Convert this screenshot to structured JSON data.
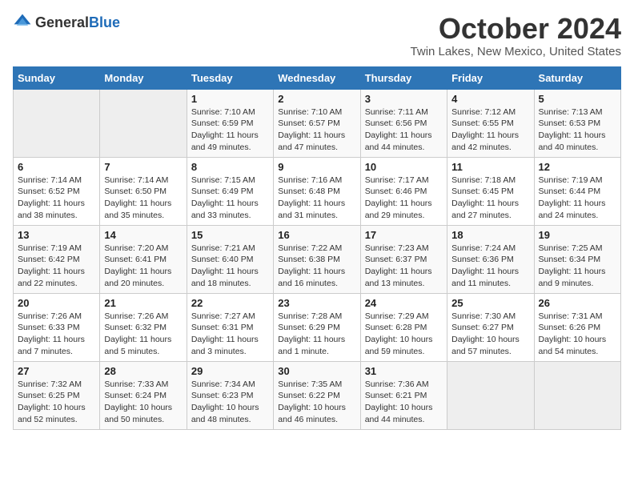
{
  "header": {
    "logo_general": "General",
    "logo_blue": "Blue",
    "title": "October 2024",
    "subtitle": "Twin Lakes, New Mexico, United States"
  },
  "days_of_week": [
    "Sunday",
    "Monday",
    "Tuesday",
    "Wednesday",
    "Thursday",
    "Friday",
    "Saturday"
  ],
  "weeks": [
    [
      {
        "day": "",
        "info": ""
      },
      {
        "day": "",
        "info": ""
      },
      {
        "day": "1",
        "info": "Sunrise: 7:10 AM\nSunset: 6:59 PM\nDaylight: 11 hours and 49 minutes."
      },
      {
        "day": "2",
        "info": "Sunrise: 7:10 AM\nSunset: 6:57 PM\nDaylight: 11 hours and 47 minutes."
      },
      {
        "day": "3",
        "info": "Sunrise: 7:11 AM\nSunset: 6:56 PM\nDaylight: 11 hours and 44 minutes."
      },
      {
        "day": "4",
        "info": "Sunrise: 7:12 AM\nSunset: 6:55 PM\nDaylight: 11 hours and 42 minutes."
      },
      {
        "day": "5",
        "info": "Sunrise: 7:13 AM\nSunset: 6:53 PM\nDaylight: 11 hours and 40 minutes."
      }
    ],
    [
      {
        "day": "6",
        "info": "Sunrise: 7:14 AM\nSunset: 6:52 PM\nDaylight: 11 hours and 38 minutes."
      },
      {
        "day": "7",
        "info": "Sunrise: 7:14 AM\nSunset: 6:50 PM\nDaylight: 11 hours and 35 minutes."
      },
      {
        "day": "8",
        "info": "Sunrise: 7:15 AM\nSunset: 6:49 PM\nDaylight: 11 hours and 33 minutes."
      },
      {
        "day": "9",
        "info": "Sunrise: 7:16 AM\nSunset: 6:48 PM\nDaylight: 11 hours and 31 minutes."
      },
      {
        "day": "10",
        "info": "Sunrise: 7:17 AM\nSunset: 6:46 PM\nDaylight: 11 hours and 29 minutes."
      },
      {
        "day": "11",
        "info": "Sunrise: 7:18 AM\nSunset: 6:45 PM\nDaylight: 11 hours and 27 minutes."
      },
      {
        "day": "12",
        "info": "Sunrise: 7:19 AM\nSunset: 6:44 PM\nDaylight: 11 hours and 24 minutes."
      }
    ],
    [
      {
        "day": "13",
        "info": "Sunrise: 7:19 AM\nSunset: 6:42 PM\nDaylight: 11 hours and 22 minutes."
      },
      {
        "day": "14",
        "info": "Sunrise: 7:20 AM\nSunset: 6:41 PM\nDaylight: 11 hours and 20 minutes."
      },
      {
        "day": "15",
        "info": "Sunrise: 7:21 AM\nSunset: 6:40 PM\nDaylight: 11 hours and 18 minutes."
      },
      {
        "day": "16",
        "info": "Sunrise: 7:22 AM\nSunset: 6:38 PM\nDaylight: 11 hours and 16 minutes."
      },
      {
        "day": "17",
        "info": "Sunrise: 7:23 AM\nSunset: 6:37 PM\nDaylight: 11 hours and 13 minutes."
      },
      {
        "day": "18",
        "info": "Sunrise: 7:24 AM\nSunset: 6:36 PM\nDaylight: 11 hours and 11 minutes."
      },
      {
        "day": "19",
        "info": "Sunrise: 7:25 AM\nSunset: 6:34 PM\nDaylight: 11 hours and 9 minutes."
      }
    ],
    [
      {
        "day": "20",
        "info": "Sunrise: 7:26 AM\nSunset: 6:33 PM\nDaylight: 11 hours and 7 minutes."
      },
      {
        "day": "21",
        "info": "Sunrise: 7:26 AM\nSunset: 6:32 PM\nDaylight: 11 hours and 5 minutes."
      },
      {
        "day": "22",
        "info": "Sunrise: 7:27 AM\nSunset: 6:31 PM\nDaylight: 11 hours and 3 minutes."
      },
      {
        "day": "23",
        "info": "Sunrise: 7:28 AM\nSunset: 6:29 PM\nDaylight: 11 hours and 1 minute."
      },
      {
        "day": "24",
        "info": "Sunrise: 7:29 AM\nSunset: 6:28 PM\nDaylight: 10 hours and 59 minutes."
      },
      {
        "day": "25",
        "info": "Sunrise: 7:30 AM\nSunset: 6:27 PM\nDaylight: 10 hours and 57 minutes."
      },
      {
        "day": "26",
        "info": "Sunrise: 7:31 AM\nSunset: 6:26 PM\nDaylight: 10 hours and 54 minutes."
      }
    ],
    [
      {
        "day": "27",
        "info": "Sunrise: 7:32 AM\nSunset: 6:25 PM\nDaylight: 10 hours and 52 minutes."
      },
      {
        "day": "28",
        "info": "Sunrise: 7:33 AM\nSunset: 6:24 PM\nDaylight: 10 hours and 50 minutes."
      },
      {
        "day": "29",
        "info": "Sunrise: 7:34 AM\nSunset: 6:23 PM\nDaylight: 10 hours and 48 minutes."
      },
      {
        "day": "30",
        "info": "Sunrise: 7:35 AM\nSunset: 6:22 PM\nDaylight: 10 hours and 46 minutes."
      },
      {
        "day": "31",
        "info": "Sunrise: 7:36 AM\nSunset: 6:21 PM\nDaylight: 10 hours and 44 minutes."
      },
      {
        "day": "",
        "info": ""
      },
      {
        "day": "",
        "info": ""
      }
    ]
  ]
}
